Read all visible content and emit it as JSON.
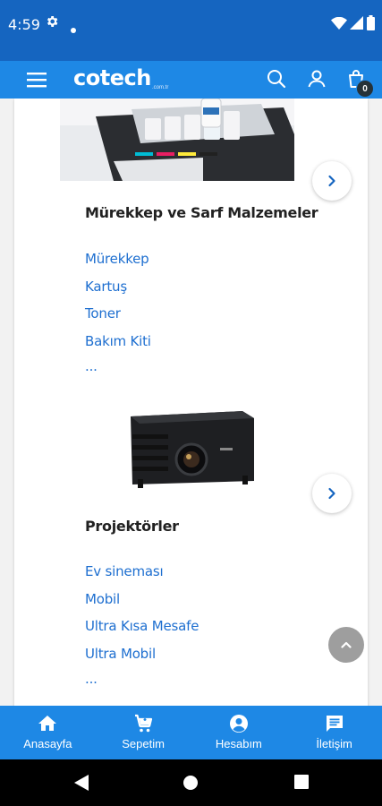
{
  "status_bar": {
    "time": "4:59",
    "icons": [
      "gear-icon",
      "dot-icon",
      "wifi-icon",
      "signal-icon",
      "battery-icon"
    ]
  },
  "app_bar": {
    "logo": "cotech",
    "logo_suffix": ".com.tr",
    "icons": [
      "menu-icon",
      "search-icon",
      "account-icon",
      "cart-icon"
    ],
    "cart_count": "0"
  },
  "sections": [
    {
      "title": "Mürekkep ve Sarf Malzemeler",
      "image": "printer-ink-tank-image",
      "links": [
        "Mürekkep",
        "Kartuş",
        "Toner",
        "Bakım Kiti",
        "..."
      ]
    },
    {
      "title": "Projektörler",
      "image": "projector-image",
      "links": [
        "Ev sineması",
        "Mobil",
        "Ultra Kısa Mesafe",
        "Ultra Mobil",
        "..."
      ]
    }
  ],
  "bottom_nav": [
    {
      "label": "Anasayfa",
      "icon": "home-icon"
    },
    {
      "label": "Sepetim",
      "icon": "cart-icon"
    },
    {
      "label": "Hesabım",
      "icon": "account-circle-icon"
    },
    {
      "label": "İletişim",
      "icon": "chat-icon"
    }
  ],
  "colors": {
    "status_bar": "#1565c0",
    "app_bar": "#1e88e5",
    "link": "#1e6fd0",
    "scroll_top": "#9e9e9e"
  }
}
